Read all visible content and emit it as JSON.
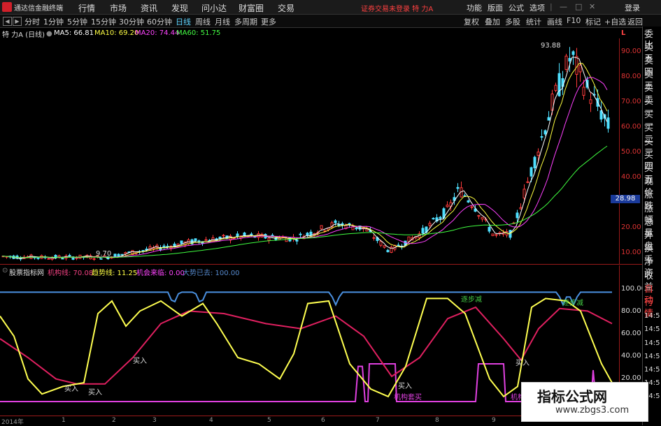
{
  "title_bar": {
    "app_name": "通达信金融终端",
    "menus": [
      "行情",
      "市场",
      "资讯",
      "发现",
      "问小达",
      "财富圈",
      "交易"
    ],
    "broker_notice": "证券交易未登录 特 力A",
    "right_buttons": [
      "功能",
      "版面",
      "公式",
      "选项",
      "|",
      "登录"
    ]
  },
  "period_bar": {
    "periods": [
      "分时",
      "1分钟",
      "5分钟",
      "15分钟",
      "30分钟",
      "60分钟",
      "日线",
      "周线",
      "月线",
      "多周期",
      "更多"
    ],
    "active_period": "日线",
    "tools": [
      "复权",
      "叠加",
      "多股",
      "统计",
      "画线",
      "F10",
      "标记",
      "+自选",
      "返回"
    ]
  },
  "price_panel": {
    "stock_name": "特 力A (日线)",
    "ma5": "MA5: 66.81",
    "ma10": "MA10: 69.20",
    "ma20": "MA20: 74.44",
    "ma60": "MA60: 51.75",
    "high_label": "93.88",
    "low_label": "9.70",
    "current_price": "28.98",
    "price_axis": [
      "90.00",
      "80.00",
      "70.00",
      "60.00",
      "50.00",
      "40.00",
      "30.00",
      "20.00",
      "10.00"
    ],
    "corner_label": "L"
  },
  "indicator_panel": {
    "name": "股票指标网",
    "line1": "机构线: 70.08",
    "line2": "趋势线: 11.25",
    "line3": "机会来临: 0.00",
    "line4": "大势已去: 100.00",
    "axis": [
      "100.00",
      "80.00",
      "60.00",
      "40.00",
      "20.00"
    ],
    "annotations": [
      "买入",
      "买入",
      "买入",
      "买入",
      "买入",
      "逐步减",
      "逐步减",
      "机构套买",
      "机构"
    ]
  },
  "right_list": [
    "委比",
    "卖五",
    "卖四",
    "卖三",
    "卖二",
    "卖一",
    "买一",
    "买二",
    "买三",
    "买四",
    "买五",
    "现价",
    "涨跌",
    "涨幅",
    "总量",
    "外盘",
    "换手",
    "净资",
    "收益",
    "自动",
    "行情",
    "14:5",
    "14:5",
    "14:5",
    "14:5",
    "14:5",
    "14:5",
    "14:5"
  ],
  "date_axis": [
    "2014年",
    "1",
    "2",
    "3",
    "4",
    "5",
    "6",
    "7",
    "8",
    "9"
  ],
  "watermark": {
    "line1": "指标公式网",
    "line2": "www.zbgs3.com"
  },
  "colors": {
    "background": "#000000",
    "up": "#ff3b3b",
    "down": "#4fe0ff",
    "ma5": "#ffffff",
    "ma10": "#ffff40",
    "ma20": "#ff40ff",
    "ma60": "#40ff40",
    "axis": "#9a1a1a"
  }
}
